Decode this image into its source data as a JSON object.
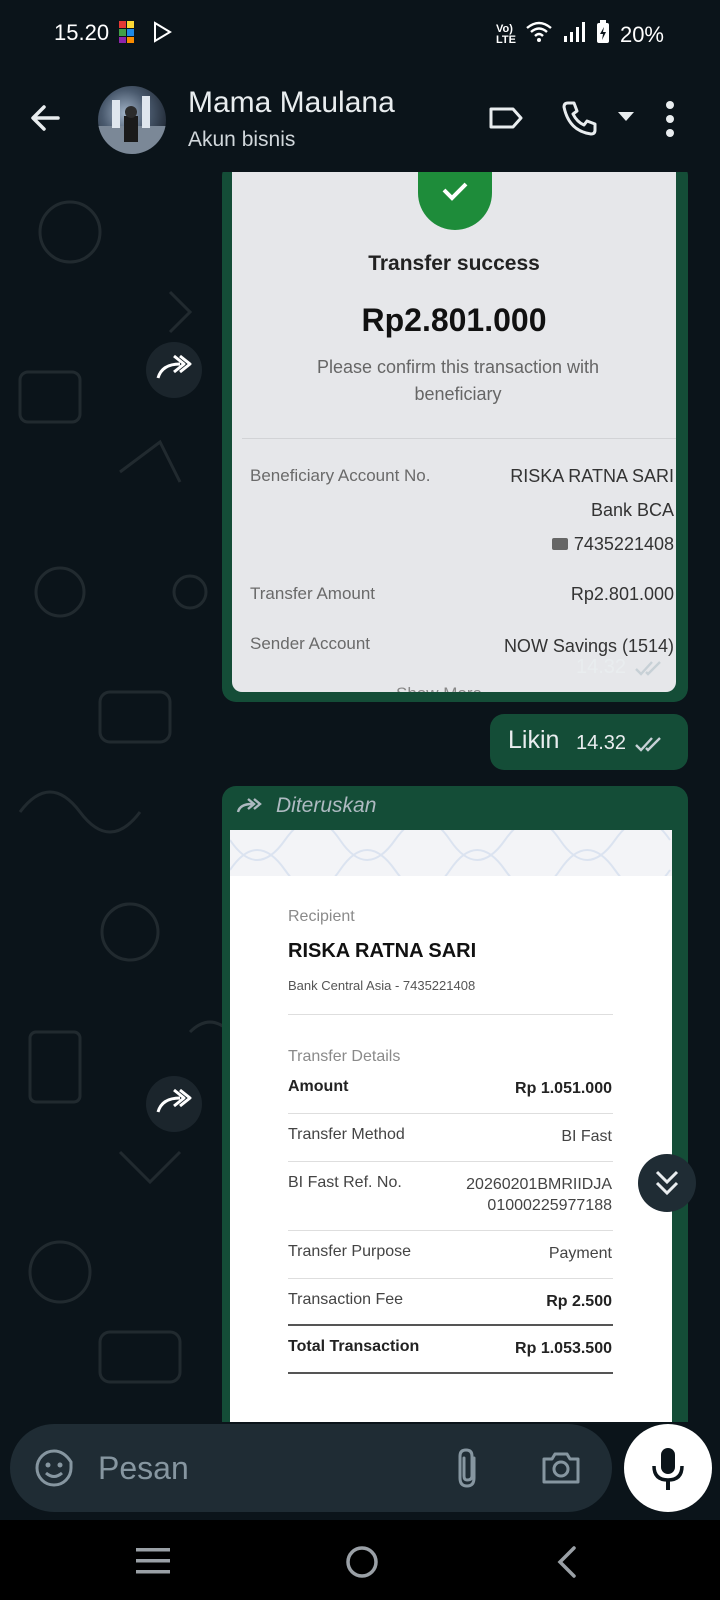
{
  "status": {
    "time": "15.20",
    "battery": "20%",
    "network": "VoLTE"
  },
  "header": {
    "name": "Mama Maulana",
    "subtitle": "Akun bisnis"
  },
  "messages": {
    "img1": {
      "title": "Transfer success",
      "amount": "Rp2.801.000",
      "confirm": "Please confirm this transaction with beneficiary",
      "rows": [
        {
          "label": "Beneficiary Account No.",
          "value1": "RISKA RATNA SARI",
          "value2": "Bank BCA",
          "value3": "7435221408"
        },
        {
          "label": "Transfer Amount",
          "value": "Rp2.801.000"
        },
        {
          "label": "Sender Account",
          "value": "NOW Savings (1514)"
        }
      ],
      "show_more": "Show More",
      "time": "14.32"
    },
    "text1": {
      "text": "Likin",
      "time": "14.32"
    },
    "img2": {
      "forwarded_label": "Diteruskan",
      "recipient_label": "Recipient",
      "recipient_name": "RISKA RATNA SARI",
      "recipient_bank": "Bank Central Asia - 7435221408",
      "details_label": "Transfer Details",
      "rows": [
        {
          "label": "Amount",
          "value": "Rp 1.051.000"
        },
        {
          "label": "Transfer Method",
          "value": "BI Fast"
        },
        {
          "label": "BI Fast Ref. No.",
          "value": "20260201BMRIIDJA",
          "value_line2": "01000225977188"
        },
        {
          "label": "Transfer Purpose",
          "value": "Payment"
        },
        {
          "label": "Transaction Fee",
          "value": "Rp 2.500"
        },
        {
          "label": "Total Transaction",
          "value": "Rp 1.053.500"
        }
      ]
    }
  },
  "input": {
    "placeholder": "Pesan"
  },
  "colors": {
    "bg": "#0b141a",
    "bubble_out": "#144d37",
    "read_ticks": "#e9edef"
  }
}
